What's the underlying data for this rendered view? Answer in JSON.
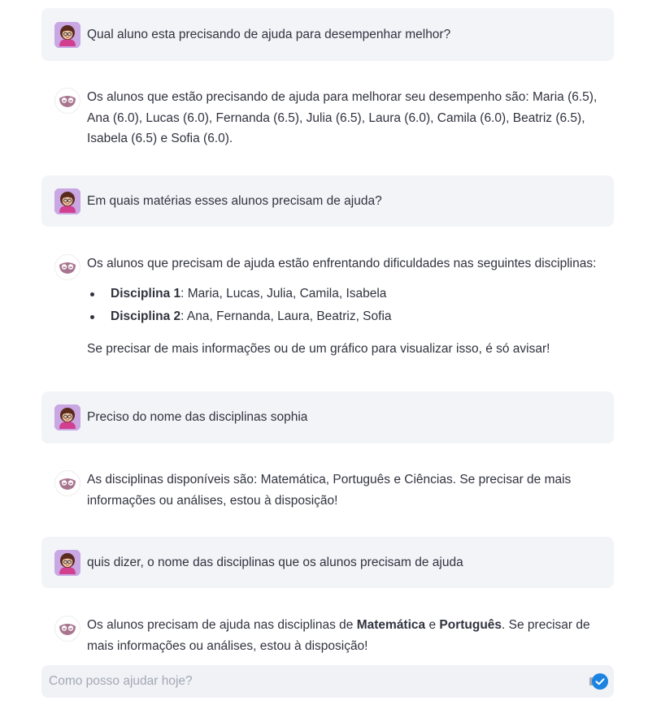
{
  "messages": [
    {
      "role": "user",
      "text": "Qual aluno esta precisando de ajuda para desempenhar melhor?"
    },
    {
      "role": "assistant",
      "text": "Os alunos que estão precisando de ajuda para melhorar seu desempenho são: Maria (6.5), Ana (6.0), Lucas (6.0), Fernanda (6.5), Julia (6.5), Laura (6.0), Camila (6.0), Beatriz (6.5), Isabela (6.5) e Sofia (6.0)."
    },
    {
      "role": "user",
      "text": "Em quais matérias esses alunos precisam de ajuda?"
    },
    {
      "role": "assistant",
      "intro": "Os alunos que precisam de ajuda estão enfrentando dificuldades nas seguintes disciplinas:",
      "items": [
        {
          "label": "Disciplina 1",
          "rest": ": Maria, Lucas, Julia, Camila, Isabela"
        },
        {
          "label": "Disciplina 2",
          "rest": ": Ana, Fernanda, Laura, Beatriz, Sofia"
        }
      ],
      "outro": "Se precisar de mais informações ou de um gráfico para visualizar isso, é só avisar!"
    },
    {
      "role": "user",
      "text": "Preciso do nome das disciplinas sophia"
    },
    {
      "role": "assistant",
      "text": "As disciplinas disponíveis são: Matemática, Português e Ciências. Se precisar de mais informações ou análises, estou à disposição!"
    },
    {
      "role": "user",
      "text": "quis dizer, o nome das disciplinas que os alunos precisam de ajuda"
    },
    {
      "role": "assistant",
      "part1": "Os alunos precisam de ajuda nas disciplinas de ",
      "bold1": "Matemática",
      "part2": " e ",
      "bold2": "Português",
      "part3": ". Se precisar de mais informações ou análises, estou à disposição!"
    }
  ],
  "chat_input": {
    "placeholder": "Como posso ajudar hoje?",
    "value": ""
  },
  "icons": {
    "user_avatar": "girl-avatar-icon",
    "assistant_avatar": "owl-logo-icon",
    "send": "send-check-icon"
  },
  "colors": {
    "user_bubble": "#f3f4f8",
    "text": "#31333f",
    "send": "#1c83e1",
    "user_avatar_bg": "#c9a7e3"
  }
}
